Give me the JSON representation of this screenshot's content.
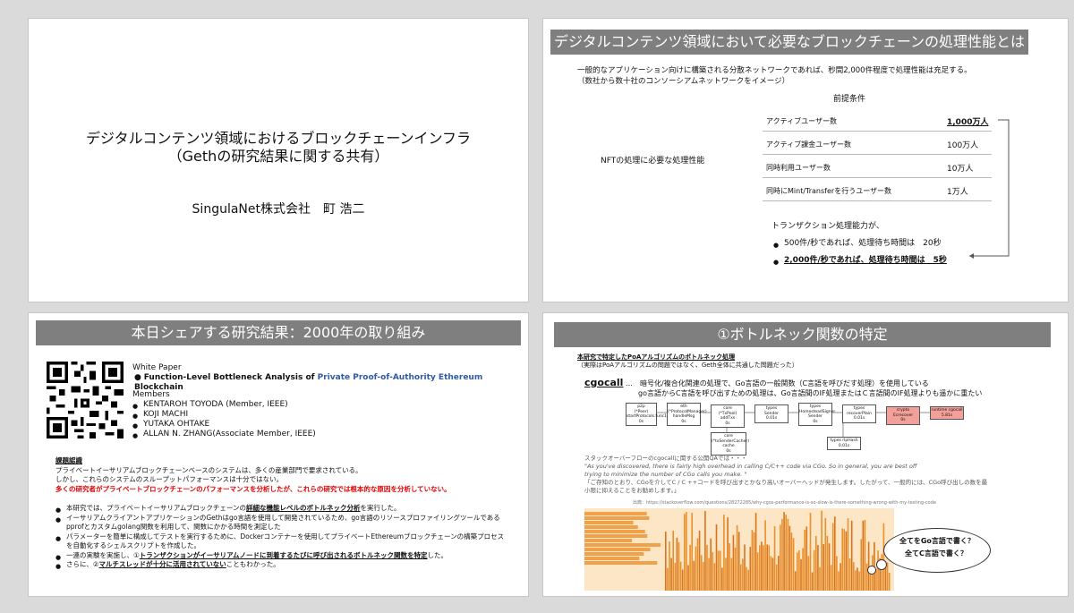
{
  "slide1": {
    "title_line1": "デジタルコンテンツ領域におけるブロックチェーンインフラ",
    "title_line2": "（Gethの研究結果に関する共有）",
    "presenter": "SingulaNet株式会社　町 浩二"
  },
  "slide2": {
    "heading": "デジタルコンテンツ領域において必要なブロックチェーンの処理性能とは",
    "intro_line1": "一般的なアプリケーション向けに構築される分散ネットワークであれば、秒間2,000件程度で処理性能は充足する。",
    "intro_line2": "（数社から数十社のコンソーシアムネットワークをイメージ）",
    "preconditions_label": "前提条件",
    "nft_label": "NFTの処理に必要な処理性能",
    "rows": [
      {
        "label": "アクティブユーザー数",
        "value": "1,000万人"
      },
      {
        "label": "アクティブ課金ユーザー数",
        "value": "100万人"
      },
      {
        "label": "同時利用ユーザー数",
        "value": "10万人"
      },
      {
        "label": "同時にMint/Transferを行うユーザー数",
        "value": "1万人"
      }
    ],
    "tx_label": "トランザクション処理能力が、",
    "bullet1": "500件/秒であれば、処理待ち時間は　20秒",
    "bullet2": "2,000件/秒であれば、処理待ち時間は　5秒"
  },
  "slide3": {
    "heading": "本日シェアする研究結果：2000年の取り組み",
    "paper_label": "White Paper",
    "paper_prefix": "Function-Level Bottleneck Analysis of ",
    "paper_highlight": "Private Proof-of-Authority Ethereum",
    "paper_suffix": " Blockchain",
    "members_label": "Members",
    "members": [
      "KENTAROH TOYODA (Member, IEEE)",
      "KOJI MACHI",
      "YUTAKA OHTAKE",
      "ALLAN N. ZHANG(Associate Member, IEEE)"
    ],
    "issue_title": "課題認識",
    "issue_line1": "プライベートイーサリアムブロックチェーンベースのシステムは、多くの産業部門で要求されている。",
    "issue_line2": "しかし、これらのシステムのスループットパフォーマンスは十分ではない。",
    "issue_red": "多くの研究者がプライベートブロックチェーンのパフォーマンスを分析したが、これらの研究では根本的な原因を分析していない。",
    "b1_prefix": "本研究では、プライベートイーサリアムブロックチェーンの",
    "b1_bold": "詳細な機能レベルのボトルネック分析",
    "b1_suffix": "を実行した。",
    "b2_line1": "イーサリアムクライアントアプリケーションのGethはgo言語を使用して開発されているため、go言語のリソースプロファイリングツールである",
    "b2_line2": "pprofとカスタムgolang関数を利用して、関数にかかる時間を測定した",
    "b3_line1": "パラメーターを簡単に構成してテストを実行するために、Dockerコンテナーを使用してプライベートEthereumブロックチェーンの構築プロセス",
    "b3_line2": "を自動化するシェルスクリプトを作成した。",
    "b4_prefix": "一連の実験を実施し、①",
    "b4_bold": "トランザクションがイーサリアムノードに到着するたびに呼び出されるボトルネック関数を特定",
    "b4_suffix": "した。",
    "b5_prefix": "さらに、②",
    "b5_bold": "マルチスレッドが十分に活用されていない",
    "b5_suffix": "こともわかった。"
  },
  "slide4": {
    "heading": "①ボトルネック関数の特定",
    "sub_title": "本研究で特定したPoAアルゴリズムのボトルネック処理",
    "sub_note": "（実際はPoAアルゴリズムの問題ではなく、Geth全体に共通した問題だった）",
    "cgocall": "cgocall",
    "cgo_desc1": "…　暗号化/複合化関連の処理で、Go言語の一般関数（C言語を呼びだす処理）を使用している",
    "cgo_desc2": "go言語からC言語を呼び出すための処理は、Go言語間のIF処理またはＣ言語間のIF処理よりも遥かに重たい",
    "nodes": [
      {
        "l1": "p2p",
        "l2": "(*Peer)",
        "l3": "startProtocols.func1",
        "l4": "0s"
      },
      {
        "l1": "eth",
        "l2": "(*ProtocolManager)",
        "l3": "handleMsg",
        "l4": "0s"
      },
      {
        "l1": "core",
        "l2": "(*TxPool) addTxs",
        "l3": "0s",
        "l4": ""
      },
      {
        "l1": "types",
        "l2": "Sender",
        "l3": "0.01s",
        "l4": ""
      },
      {
        "l1": "types",
        "l2": "HomesteadSigner",
        "l3": "Sender",
        "l4": "0s"
      },
      {
        "l1": "types",
        "l2": "recoverPlain",
        "l3": "0.01s",
        "l4": ""
      },
      {
        "l1": "crypto Ecrecover",
        "l2": "0s",
        "l3": "",
        "l4": ""
      },
      {
        "l1": "runtime cgocall",
        "l2": "5.81s",
        "l3": "",
        "l4": ""
      },
      {
        "l1": "core",
        "l2": "(*txSenderCacher)",
        "l3": "cache",
        "l4": "0s"
      },
      {
        "l1": "types rlpHash",
        "l2": "0.01s",
        "l3": "",
        "l4": ""
      }
    ],
    "so_title": "スタックオーバーフローのcgocallに関する公開QAでは・・・",
    "so_quote1": "\"As you've discovered, there is fairly high overhead in calling C/C++ code via CGo. So in general, you are best off",
    "so_quote2": "trying to minimize the number of CGo calls you make. \"",
    "so_jp1": "「ご存知のとおり、CGoを介してC / C ++コードを呼び出すとかなり高いオーバーヘッドが発生します。したがって、一般的には、CGo呼び出しの数を最",
    "so_jp2": "小限に抑えることをお勧めします。」",
    "source": "出典：https://stackoverflow.com/questions/28272285/why-cgos-performance-is-so-slow-is-there-something-wrong-with-my-testing-code",
    "bubble1": "全てをGo言語で書く？",
    "bubble2": "全てC言語で書く？"
  },
  "colors": {
    "heading_bar": "#7f7f7f",
    "emphasis_red": "#e00000",
    "paper_blue": "#2f5aa6",
    "flame_orange": "#e8912c",
    "node_red": "#f4a09a"
  }
}
